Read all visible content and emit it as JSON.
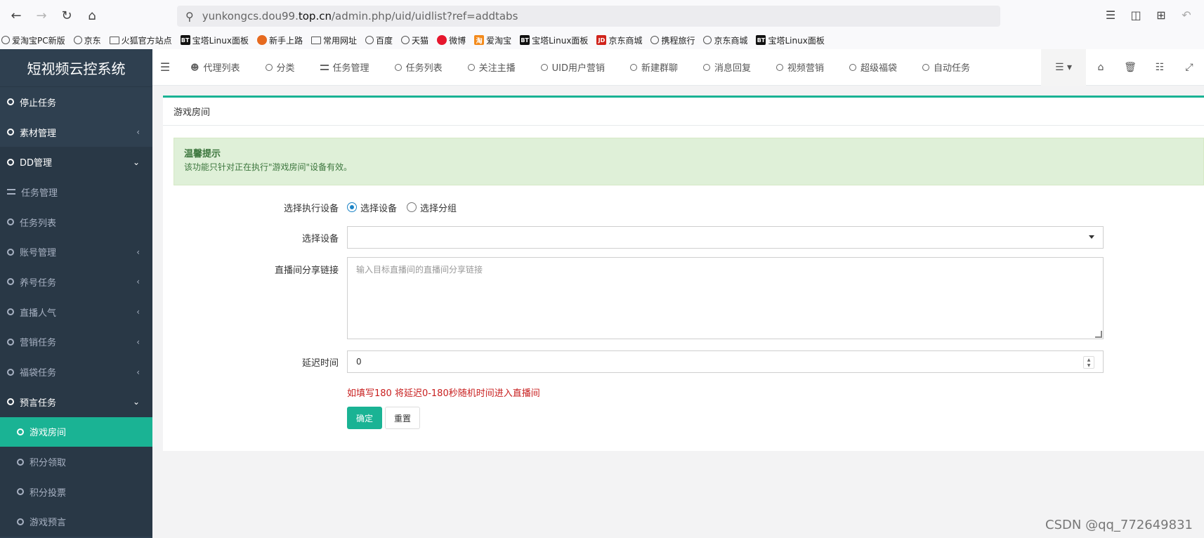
{
  "browser": {
    "url_prefix": "yunkongcs.dou99.",
    "url_domain": "top.cn",
    "url_suffix": "/admin.php/uid/uidlist?ref=addtabs"
  },
  "bookmarks": [
    {
      "label": "爱淘宝PC新版",
      "icon": "globe"
    },
    {
      "label": "京东",
      "icon": "globe"
    },
    {
      "label": "火狐官方站点",
      "icon": "folder"
    },
    {
      "label": "宝塔Linux面板",
      "icon": "bt"
    },
    {
      "label": "新手上路",
      "icon": "fox"
    },
    {
      "label": "常用网址",
      "icon": "folder"
    },
    {
      "label": "百度",
      "icon": "globe"
    },
    {
      "label": "天猫",
      "icon": "globe"
    },
    {
      "label": "微博",
      "icon": "weibo"
    },
    {
      "label": "爱淘宝",
      "icon": "tao"
    },
    {
      "label": "宝塔Linux面板",
      "icon": "bt"
    },
    {
      "label": "京东商城",
      "icon": "jd"
    },
    {
      "label": "携程旅行",
      "icon": "globe"
    },
    {
      "label": "京东商城",
      "icon": "globe"
    },
    {
      "label": "宝塔Linux面板",
      "icon": "bt"
    }
  ],
  "sidebar": {
    "brand": "短视频云控系统",
    "items": [
      {
        "label": "停止任务"
      },
      {
        "label": "素材管理"
      },
      {
        "label": "DD管理"
      },
      {
        "label": "任务管理"
      },
      {
        "label": "任务列表"
      },
      {
        "label": "账号管理"
      },
      {
        "label": "养号任务"
      },
      {
        "label": "直播人气"
      },
      {
        "label": "营销任务"
      },
      {
        "label": "福袋任务"
      },
      {
        "label": "预言任务"
      },
      {
        "label": "游戏房间"
      },
      {
        "label": "积分领取"
      },
      {
        "label": "积分投票"
      },
      {
        "label": "游戏预言"
      }
    ]
  },
  "tabs": [
    {
      "label": "代理列表"
    },
    {
      "label": "分类"
    },
    {
      "label": "任务管理"
    },
    {
      "label": "任务列表"
    },
    {
      "label": "关注主播"
    },
    {
      "label": "UID用户营销"
    },
    {
      "label": "新建群聊"
    },
    {
      "label": "消息回复"
    },
    {
      "label": "视频营销"
    },
    {
      "label": "超级福袋"
    },
    {
      "label": "自动任务"
    }
  ],
  "content": {
    "panel_title": "游戏房间",
    "alert_title": "温馨提示",
    "alert_text": "该功能只针对正在执行\"游戏房间\"设备有效。",
    "form": {
      "exec_label": "选择执行设备",
      "radio_device": "选择设备",
      "radio_group": "选择分组",
      "device_label": "选择设备",
      "link_label": "直播间分享链接",
      "link_placeholder": "输入目标直播间的直播间分享链接",
      "delay_label": "延迟时间",
      "delay_value": "0",
      "hint": "如填写180 将延迟0-180秒随机时间进入直播间",
      "submit": "确定",
      "reset": "重置"
    }
  },
  "watermark": "CSDN @qq_772649831",
  "colors": {
    "accent": "#1ab394",
    "sidebar_bg": "#2f4050",
    "hint": "#c81e1e"
  }
}
